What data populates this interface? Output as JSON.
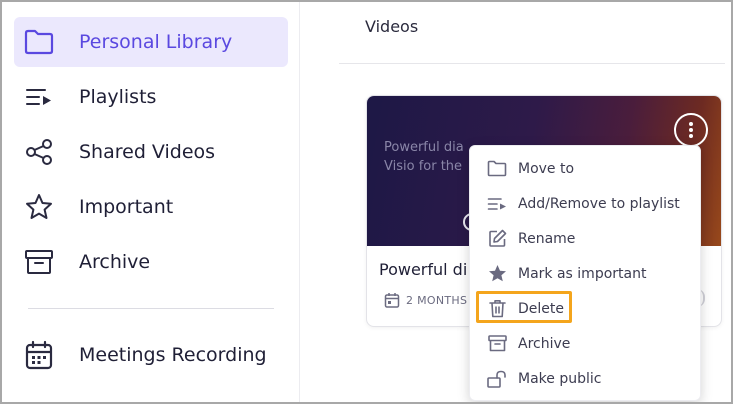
{
  "sidebar": {
    "items": [
      {
        "label": "Personal Library",
        "icon": "folder-icon",
        "active": true
      },
      {
        "label": "Playlists",
        "icon": "playlist-icon"
      },
      {
        "label": "Shared Videos",
        "icon": "share-icon"
      },
      {
        "label": "Important",
        "icon": "star-icon"
      },
      {
        "label": "Archive",
        "icon": "archive-icon"
      },
      {
        "label": "Meetings Recording",
        "icon": "calendar-icon"
      }
    ]
  },
  "main": {
    "title": "Videos",
    "card": {
      "thumbnail_text_line1": "Powerful dia",
      "thumbnail_text_line2": "Visio for the",
      "title": "Powerful di",
      "meta": "2 MONTHS"
    }
  },
  "context_menu": {
    "items": [
      {
        "label": "Move to",
        "icon": "folder-icon"
      },
      {
        "label": "Add/Remove to playlist",
        "icon": "playlist-icon"
      },
      {
        "label": "Rename",
        "icon": "edit-icon"
      },
      {
        "label": "Mark as important",
        "icon": "star-filled-icon"
      },
      {
        "label": "Delete",
        "icon": "trash-icon",
        "highlighted": true
      },
      {
        "label": "Archive",
        "icon": "archive-icon"
      },
      {
        "label": "Make public",
        "icon": "unlock-icon"
      }
    ]
  },
  "colors": {
    "accent": "#5a48e0",
    "active_bg": "#ebe8fd",
    "highlight": "#f4a51c"
  }
}
